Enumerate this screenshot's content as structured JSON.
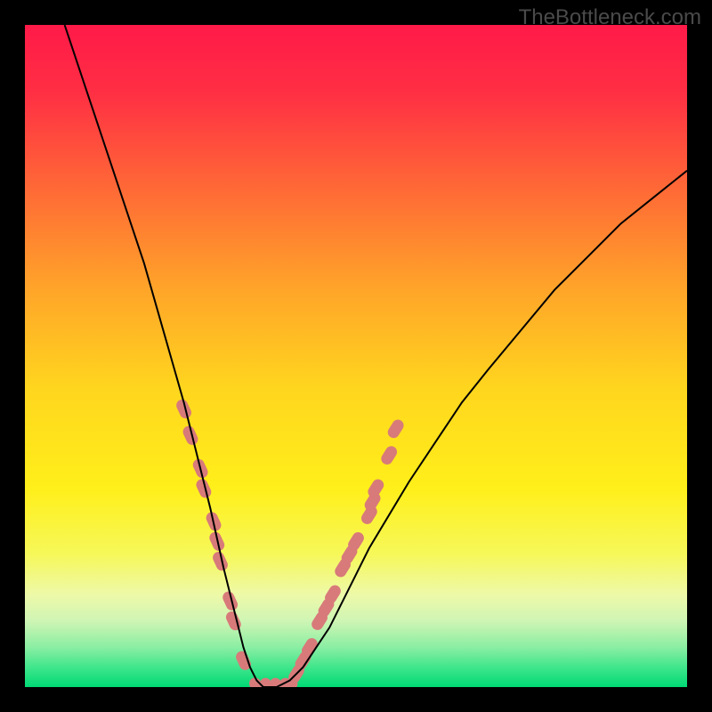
{
  "watermark": "TheBottleneck.com",
  "chart_data": {
    "type": "line",
    "title": "",
    "xlabel": "",
    "ylabel": "",
    "xlim": [
      0,
      100
    ],
    "ylim": [
      0,
      100
    ],
    "grid": false,
    "legend": false,
    "annotations": [],
    "background_gradient": {
      "type": "vertical",
      "stops": [
        {
          "pos": 0.0,
          "color": "#ff1a48"
        },
        {
          "pos": 0.1,
          "color": "#ff2e44"
        },
        {
          "pos": 0.25,
          "color": "#ff6a36"
        },
        {
          "pos": 0.4,
          "color": "#ffa529"
        },
        {
          "pos": 0.55,
          "color": "#ffd61e"
        },
        {
          "pos": 0.7,
          "color": "#ffef1a"
        },
        {
          "pos": 0.8,
          "color": "#f6f85a"
        },
        {
          "pos": 0.86,
          "color": "#eef9a8"
        },
        {
          "pos": 0.9,
          "color": "#cff5b4"
        },
        {
          "pos": 0.94,
          "color": "#8aeea3"
        },
        {
          "pos": 0.97,
          "color": "#40e68c"
        },
        {
          "pos": 1.0,
          "color": "#00d974"
        }
      ]
    },
    "series": [
      {
        "name": "bottleneck-curve",
        "color": "#000000",
        "stroke_width": 2,
        "x": [
          6,
          8,
          10,
          12,
          14,
          16,
          18,
          20,
          22,
          24,
          26,
          28,
          30,
          31,
          32,
          33,
          34,
          35,
          36,
          38,
          40,
          42,
          44,
          46,
          48,
          50,
          52,
          55,
          58,
          62,
          66,
          70,
          75,
          80,
          85,
          90,
          95,
          100
        ],
        "y": [
          100,
          94,
          88,
          82,
          76,
          70,
          64,
          57,
          50,
          43,
          35,
          27,
          18,
          14,
          10,
          6,
          3,
          1,
          0,
          0,
          1,
          3,
          6,
          9,
          13,
          17,
          21,
          26,
          31,
          37,
          43,
          48,
          54,
          60,
          65,
          70,
          74,
          78
        ]
      }
    ],
    "marker_clusters": [
      {
        "name": "left-cluster",
        "color": "#d87a7a",
        "shape": "capsule",
        "points": [
          {
            "x": 24,
            "y": 42
          },
          {
            "x": 25,
            "y": 38
          },
          {
            "x": 26.5,
            "y": 33
          },
          {
            "x": 27,
            "y": 30
          },
          {
            "x": 28.5,
            "y": 25
          },
          {
            "x": 29,
            "y": 22
          },
          {
            "x": 29.5,
            "y": 19
          },
          {
            "x": 31,
            "y": 13
          },
          {
            "x": 31.5,
            "y": 10
          },
          {
            "x": 33,
            "y": 4
          },
          {
            "x": 35,
            "y": 0
          },
          {
            "x": 36,
            "y": 0
          },
          {
            "x": 37.5,
            "y": 0
          },
          {
            "x": 39,
            "y": 0
          }
        ]
      },
      {
        "name": "right-cluster",
        "color": "#d87a7a",
        "shape": "capsule",
        "points": [
          {
            "x": 40,
            "y": 0
          },
          {
            "x": 41,
            "y": 2
          },
          {
            "x": 42,
            "y": 4
          },
          {
            "x": 43,
            "y": 6
          },
          {
            "x": 44.5,
            "y": 10
          },
          {
            "x": 45.5,
            "y": 12
          },
          {
            "x": 46.5,
            "y": 14
          },
          {
            "x": 48,
            "y": 18
          },
          {
            "x": 49,
            "y": 20
          },
          {
            "x": 50,
            "y": 22
          },
          {
            "x": 52,
            "y": 26
          },
          {
            "x": 52.5,
            "y": 28
          },
          {
            "x": 53,
            "y": 30
          },
          {
            "x": 55,
            "y": 35
          },
          {
            "x": 56,
            "y": 39
          }
        ]
      }
    ]
  }
}
